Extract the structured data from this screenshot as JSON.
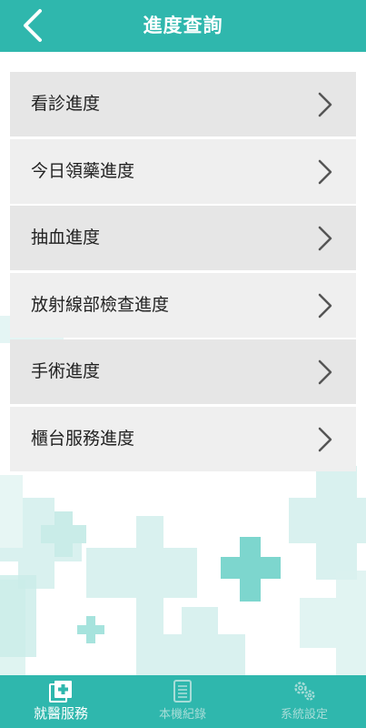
{
  "header": {
    "title": "進度查詢",
    "back_icon": "chevron-left-icon"
  },
  "menu": {
    "items": [
      {
        "label": "看診進度",
        "icon": "chevron-right-icon"
      },
      {
        "label": "今日領藥進度",
        "icon": "chevron-right-icon"
      },
      {
        "label": "抽血進度",
        "icon": "chevron-right-icon"
      },
      {
        "label": "放射線部檢查進度",
        "icon": "chevron-right-icon"
      },
      {
        "label": "手術進度",
        "icon": "chevron-right-icon"
      },
      {
        "label": "櫃台服務進度",
        "icon": "chevron-right-icon"
      }
    ]
  },
  "tabbar": {
    "tabs": [
      {
        "label": "就醫服務",
        "icon": "medical-folder-icon",
        "active": true
      },
      {
        "label": "本機紀錄",
        "icon": "notebook-icon",
        "active": false
      },
      {
        "label": "系統設定",
        "icon": "gears-icon",
        "active": false
      }
    ]
  },
  "colors": {
    "primary": "#2fb7ad",
    "menu_bg": "#e6e6e6",
    "menu_bg_alt": "#efefef",
    "text": "#222222",
    "chevron": "#555555",
    "cross_light": "#d9f1ef",
    "cross_mid": "#a6e3dd",
    "cross_strong": "#7dd6ce",
    "tab_inactive": "#a7ddd8"
  }
}
